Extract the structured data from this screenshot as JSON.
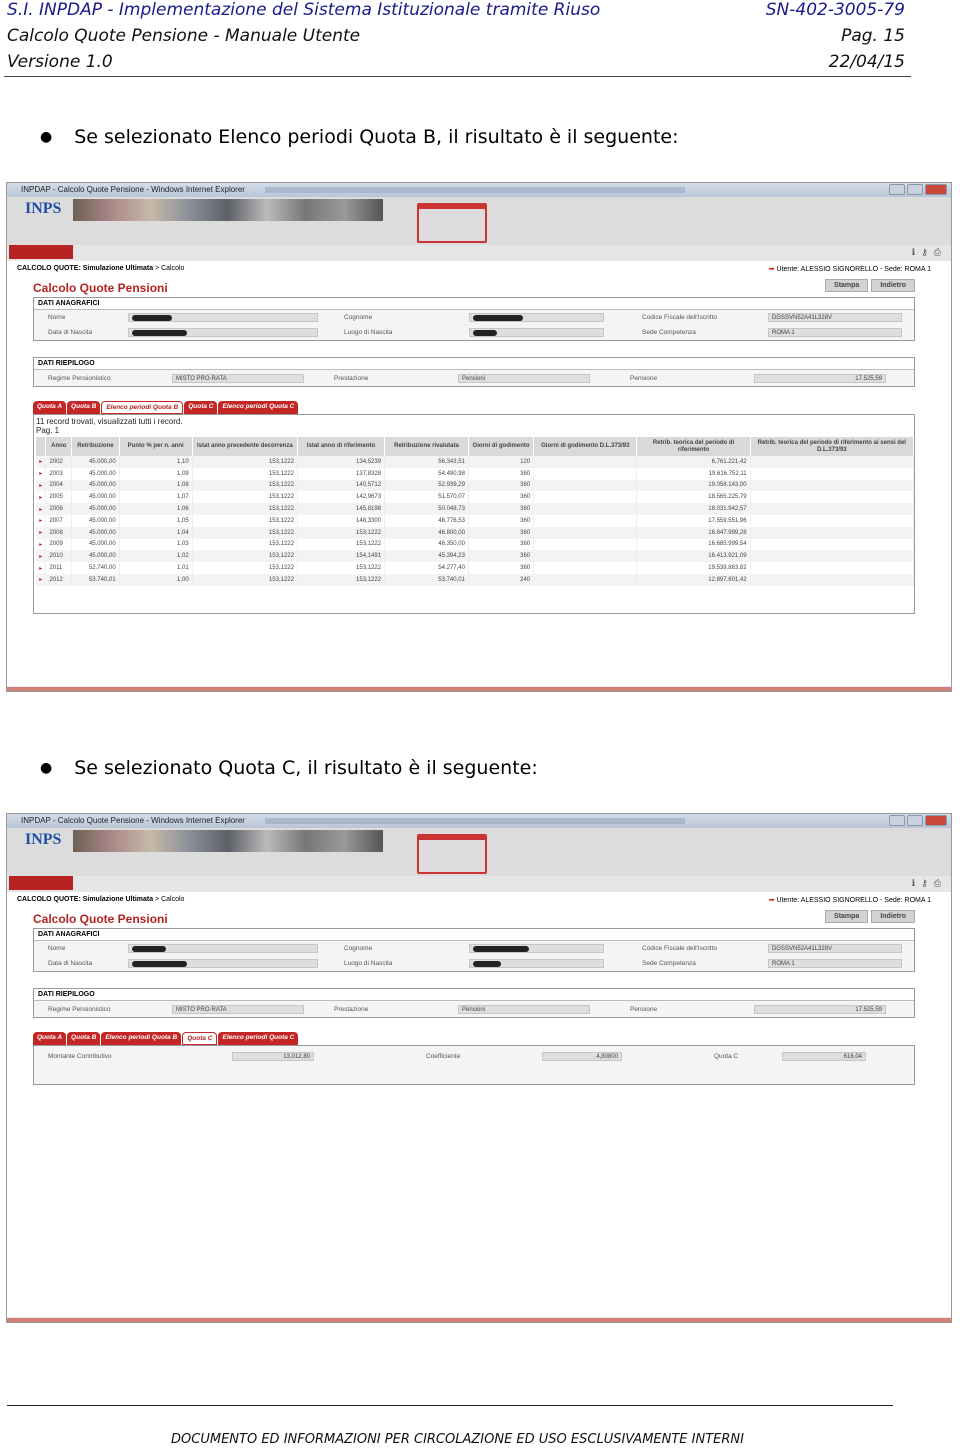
{
  "header": {
    "line1_left": "S.I. INPDAP - Implementazione del Sistema Istituzionale tramite Riuso",
    "line1_right": "SN-402-3005-79",
    "line2_left": "Calcolo Quote Pensione - Manuale Utente",
    "line2_right": "Pag. 15",
    "line3_left": "Versione 1.0",
    "line3_right": "22/04/15"
  },
  "bullets": {
    "first": "Se selezionato Elenco periodi Quota B, il risultato è il seguente:",
    "second": "Se selezionato Quota C, il risultato è il seguente:"
  },
  "app": {
    "window_title": "INPDAP - Calcolo Quote Pensione - Windows Internet Explorer",
    "logo": "INPS",
    "breadcrumb_bold": "CALCOLO QUOTE: Simulazione Ultimata",
    "breadcrumb_rest": " > Calcolo",
    "user_info": "Utente: ALESSIO SIGNORELLO - Sede: ROMA 1",
    "page_title": "Calcolo Quote Pensioni",
    "btn_print": "Stampa",
    "btn_back": "Indietro",
    "anag": {
      "title": "DATI ANAGRAFICI",
      "nome": "Nome",
      "data_nascita": "Data di Nascita",
      "cognome": "Cognome",
      "luogo_nascita": "Luogo di Nascita",
      "codice_fiscale_label": "Codice Fiscale dell'Iscritto",
      "codice_fiscale": "DGSSVN52A41L328V",
      "sede_label": "Sede Competenza",
      "sede": "ROMA 1"
    },
    "riep": {
      "title": "DATI RIEPILOGO",
      "regime_label": "Regime Pensionistico",
      "regime": "MISTO PRO-RATA",
      "prestazione_label": "Prestazione",
      "prestazione": "Pensioni",
      "pensione_label": "Pensione",
      "pensione": "17.525,59"
    },
    "tabs": [
      "Quota A",
      "Quota B",
      "Elenco periodi Quota B",
      "Quota C",
      "Elenco periodi Quota C"
    ],
    "records_info": "11 record trovati, visualizzati tutti i record.",
    "page_info": "Pag. 1",
    "columns": [
      "Anno",
      "Retribuzione",
      "Punto % per n. anni",
      "Istat anno precedente decorrenza",
      "Istat anno di riferimento",
      "Retribuzione rivalutata",
      "Giorni di godimento",
      "Giorni di godimento D.L.373/93",
      "Retrib. teorica del periodo di riferimento",
      "Retrib. teorica del periodo di riferimento ai sensi del D.L.373/93"
    ],
    "rows": [
      [
        "2002",
        "45.000,00",
        "1,10",
        "153,1222",
        "134,5239",
        "56.343,51",
        "120",
        "",
        "6.761.221,42",
        ""
      ],
      [
        "2003",
        "45.000,00",
        "1,09",
        "153,1222",
        "137,8328",
        "54.490,98",
        "360",
        "",
        "19.616.752,11",
        ""
      ],
      [
        "2004",
        "45.000,00",
        "1,08",
        "153,1222",
        "140,5712",
        "52.939,29",
        "360",
        "",
        "19.058.143,00",
        ""
      ],
      [
        "2005",
        "45.000,00",
        "1,07",
        "153,1222",
        "142,9673",
        "51.570,07",
        "360",
        "",
        "18.565.225,79",
        ""
      ],
      [
        "2006",
        "45.000,00",
        "1,06",
        "153,1222",
        "145,8198",
        "50.048,73",
        "360",
        "",
        "18.031.942,57",
        ""
      ],
      [
        "2007",
        "45.000,00",
        "1,05",
        "153,1222",
        "148,3300",
        "48.776,53",
        "360",
        "",
        "17.559.551,96",
        ""
      ],
      [
        "2008",
        "45.000,00",
        "1,04",
        "153,1222",
        "153,1222",
        "46.800,00",
        "360",
        "",
        "16.847.999,28",
        ""
      ],
      [
        "2009",
        "45.000,00",
        "1,03",
        "153,1222",
        "153,1222",
        "46.350,00",
        "360",
        "",
        "16.685.999,54",
        ""
      ],
      [
        "2010",
        "45.000,00",
        "1,02",
        "153,1222",
        "154,1491",
        "45.394,23",
        "360",
        "",
        "16.413.921,09",
        ""
      ],
      [
        "2011",
        "52.740,00",
        "1,01",
        "153,1222",
        "153,1222",
        "54.277,40",
        "360",
        "",
        "19.539.863,82",
        ""
      ],
      [
        "2012",
        "53.740,01",
        "1,00",
        "153,1222",
        "153,1222",
        "53.740,01",
        "240",
        "",
        "12.897.601,42",
        ""
      ]
    ],
    "quota_c": {
      "montante_label": "Montante Contributivo",
      "montante": "13.012,80",
      "coeff_label": "Coefficiente",
      "coeff": "4,80800",
      "quota_label": "Quota C",
      "quota": "616,04"
    }
  },
  "footer": "DOCUMENTO ED INFORMAZIONI PER CIRCOLAZIONE ED USO  ESCLUSIVAMENTE INTERNI"
}
